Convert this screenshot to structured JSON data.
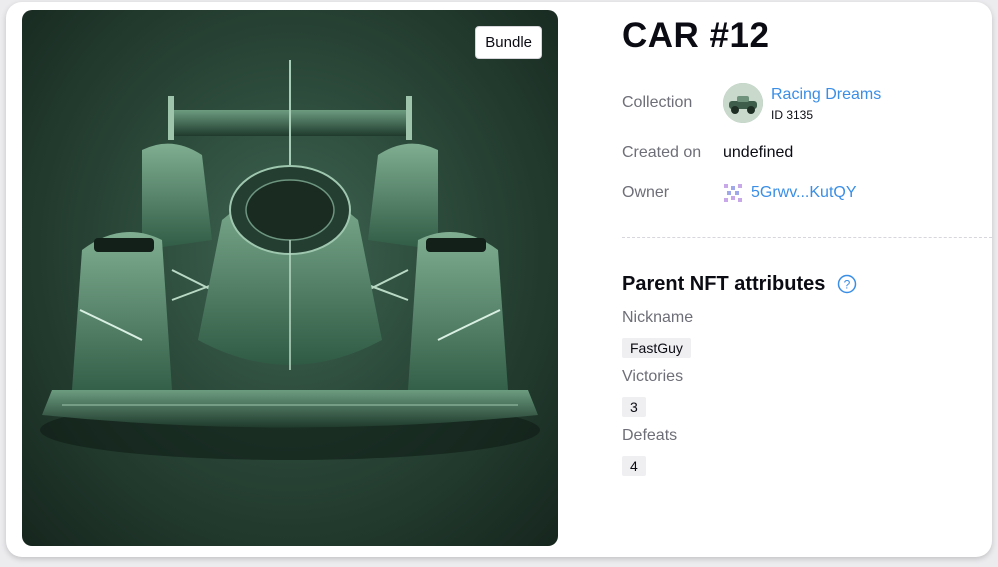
{
  "image": {
    "badge": "Bundle",
    "alt_subject": "green racing car"
  },
  "nft": {
    "title": "CAR #12",
    "collection_label": "Collection",
    "collection_name": "Racing Dreams",
    "collection_id": "ID 3135",
    "created_label": "Created on",
    "created_value": "undefined",
    "owner_label": "Owner",
    "owner_address": "5Grwv...KutQY"
  },
  "attributes": {
    "section_title": "Parent NFT attributes",
    "items": [
      {
        "label": "Nickname",
        "value": "FastGuy"
      },
      {
        "label": "Victories",
        "value": "3"
      },
      {
        "label": "Defeats",
        "value": "4"
      }
    ]
  },
  "colors": {
    "link": "#3a8ee6",
    "muted": "#6e6e78",
    "chip_bg": "#efeff1"
  },
  "icons": {
    "owner": "identicon-icon",
    "help": "help-circle-icon"
  }
}
